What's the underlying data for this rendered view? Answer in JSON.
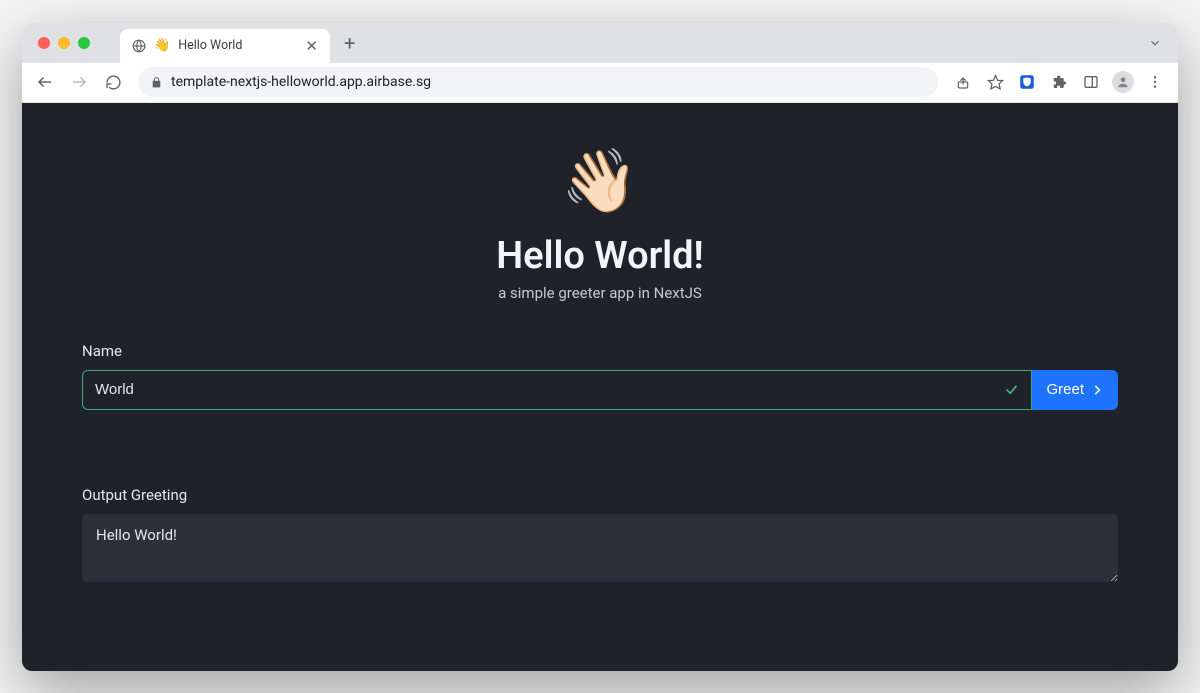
{
  "browser": {
    "tab_title": "Hello World",
    "tab_favicon": "👋",
    "url": "template-nextjs-helloworld.app.airbase.sg"
  },
  "hero": {
    "emoji": "👋🏻",
    "title": "Hello World!",
    "subtitle": "a simple greeter app in NextJS"
  },
  "form": {
    "name_label": "Name",
    "name_value": "World",
    "greet_button_label": "Greet"
  },
  "output": {
    "label": "Output Greeting",
    "value": "Hello World!"
  }
}
